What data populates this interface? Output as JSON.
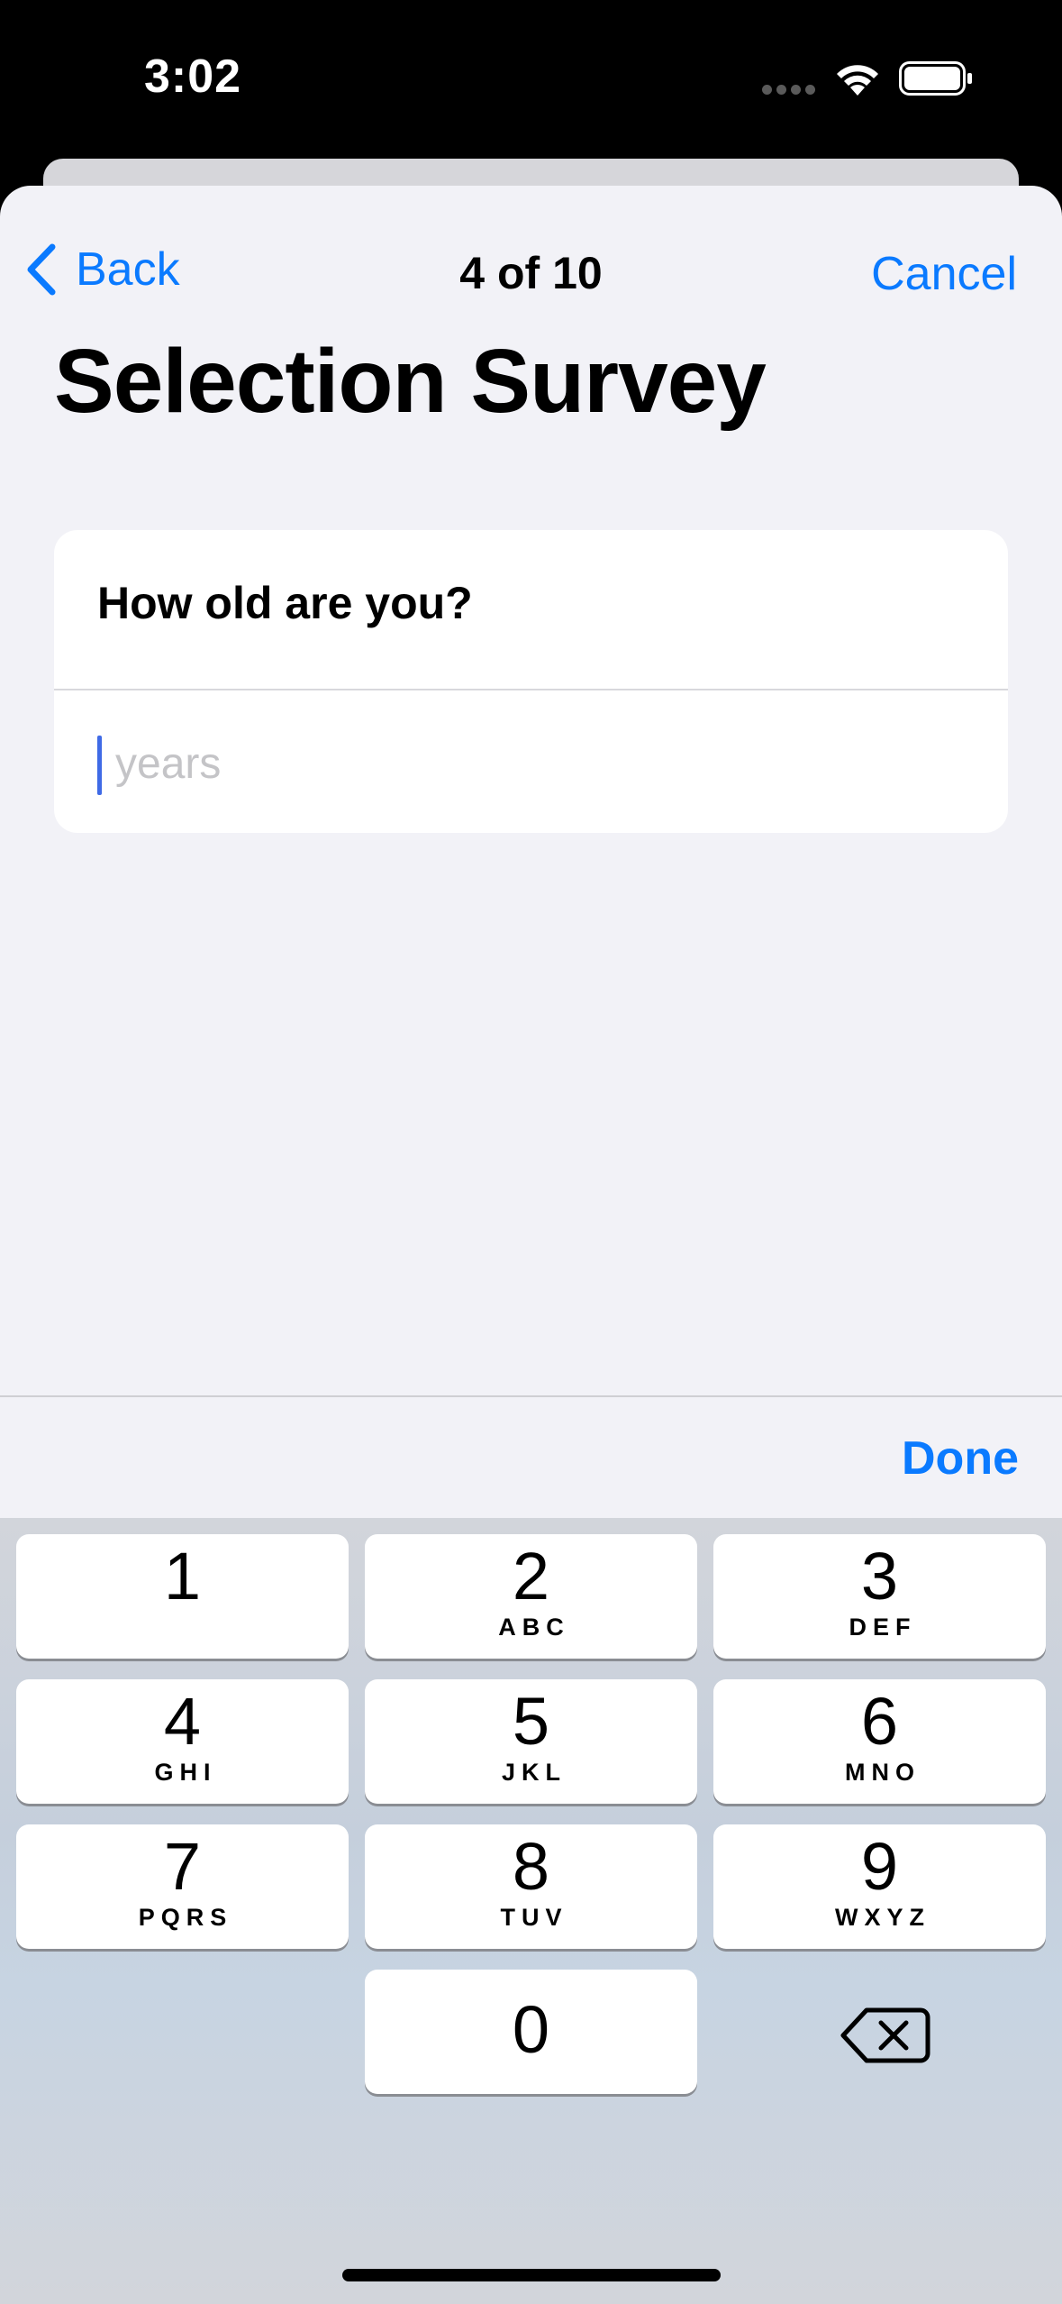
{
  "status_bar": {
    "time": "3:02"
  },
  "nav": {
    "back_label": "Back",
    "progress": "4 of 10",
    "cancel_label": "Cancel"
  },
  "page": {
    "title": "Selection Survey"
  },
  "question": {
    "text": "How old are you?",
    "answer_value": "",
    "answer_placeholder": "years"
  },
  "toolbar": {
    "done_label": "Done"
  },
  "keyboard": {
    "keys": [
      {
        "digit": "1",
        "letters": ""
      },
      {
        "digit": "2",
        "letters": "ABC"
      },
      {
        "digit": "3",
        "letters": "DEF"
      },
      {
        "digit": "4",
        "letters": "GHI"
      },
      {
        "digit": "5",
        "letters": "JKL"
      },
      {
        "digit": "6",
        "letters": "MNO"
      },
      {
        "digit": "7",
        "letters": "PQRS"
      },
      {
        "digit": "8",
        "letters": "TUV"
      },
      {
        "digit": "9",
        "letters": "WXYZ"
      },
      {
        "digit": "0",
        "letters": ""
      }
    ],
    "delete_icon": "delete-backspace-icon"
  },
  "colors": {
    "accent": "#0a7aff",
    "background": "#f2f2f7",
    "cursor": "#3f6ae6"
  }
}
